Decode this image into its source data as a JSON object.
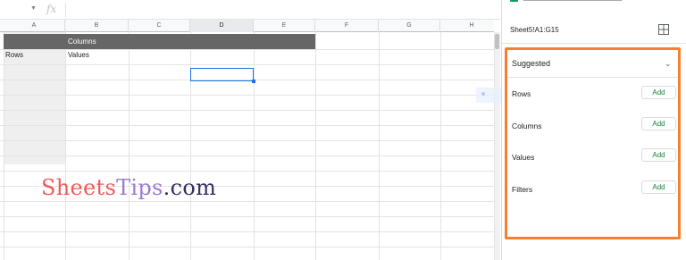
{
  "formula_bar": {
    "fx_label": "fx"
  },
  "columns": [
    "A",
    "B",
    "C",
    "D",
    "E",
    "F",
    "G",
    "H"
  ],
  "selected_column": "D",
  "pivot_table": {
    "header_label": "Columns",
    "rows_label": "Rows",
    "values_label": "Values"
  },
  "watermark": {
    "part1": "Sheets",
    "part2": "Tips",
    "part3": ".com"
  },
  "editor": {
    "range": "Sheet5!A1:G15",
    "suggested_label": "Suggested",
    "sections": [
      {
        "label": "Rows",
        "button": "Add"
      },
      {
        "label": "Columns",
        "button": "Add"
      },
      {
        "label": "Values",
        "button": "Add"
      },
      {
        "label": "Filters",
        "button": "Add"
      }
    ]
  },
  "colors": {
    "highlight_border": "#f48030",
    "add_button_text": "#188038",
    "selection_blue": "#1a73e8",
    "header_band": "#666666",
    "watermark_sheets": "#ef5b5b",
    "watermark_tips": "#9b7bd0",
    "watermark_com": "#3a2d5f"
  }
}
